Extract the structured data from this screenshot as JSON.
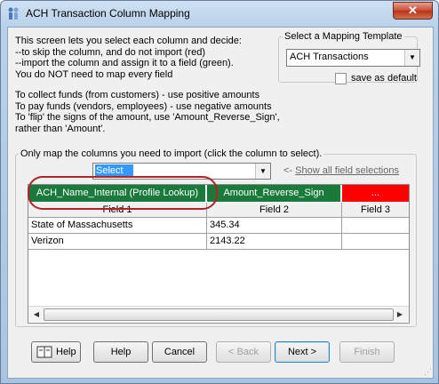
{
  "window": {
    "title": "ACH Transaction Column Mapping"
  },
  "intro": {
    "lines1": "This screen lets you select each column and decide:\n--to skip the column, and do not import (red)\n--import the column and assign it to a field (green).\nYou do NOT need to map every field",
    "lines2": "To collect funds (from customers) - use positive amounts\nTo pay funds (vendors, employees) - use negative amounts\nTo 'flip' the signs of the amount, use 'Amount_Reverse_Sign',\nrather than 'Amount'."
  },
  "template": {
    "legend": "Select a Mapping Template",
    "selected": "ACH Transactions",
    "save_default_label": "save as default"
  },
  "columns_group": {
    "legend": "Only map the columns you need to import (click the column to select).",
    "field_select_value": "Select",
    "show_all_arrow": "<-",
    "show_all_label": "Show all field selections"
  },
  "mapping_row": [
    {
      "label": "ACH_Name_Internal (Profile Lookup)",
      "color": "#1a7a3c"
    },
    {
      "label": "Amount_Reverse_Sign",
      "color": "#1a7a3c"
    },
    {
      "label": "...",
      "color": "#ff0000"
    }
  ],
  "grid": {
    "headers": [
      "Field 1",
      "Field 2",
      "Field 3"
    ],
    "rows": [
      [
        "State of Massachusetts",
        "345.34",
        ""
      ],
      [
        "Verizon",
        "2143.22",
        ""
      ]
    ]
  },
  "buttons": {
    "help_icon": "Help",
    "help": "Help",
    "cancel": "Cancel",
    "back": "< Back",
    "next": "Next >",
    "finish": "Finish"
  }
}
